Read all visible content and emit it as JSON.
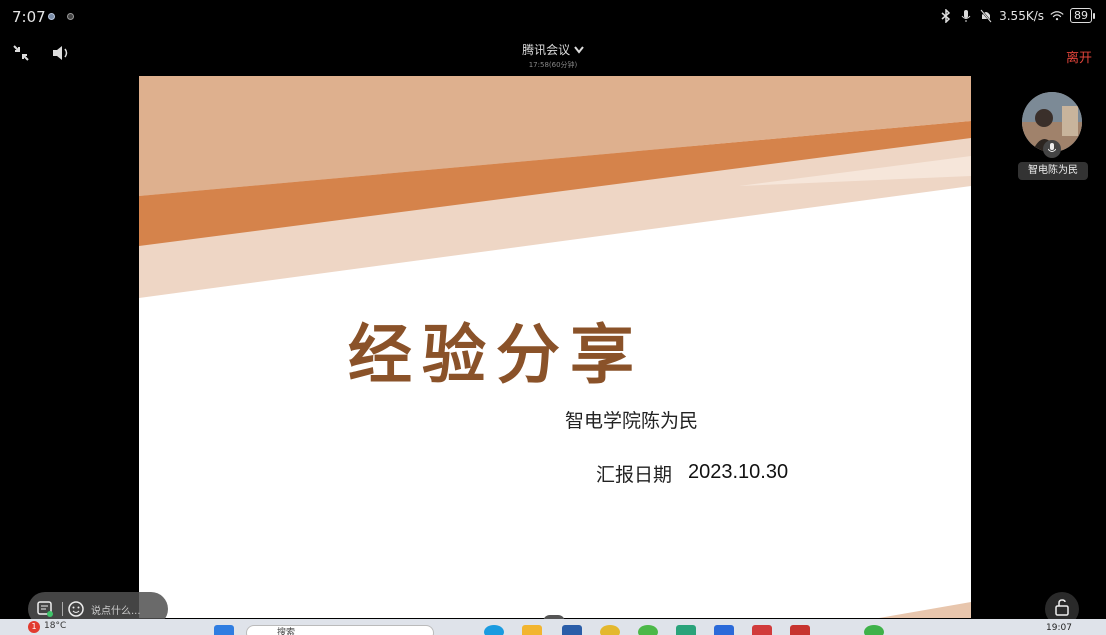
{
  "status_bar": {
    "time": "7:07",
    "network_speed": "3.55K/s",
    "battery": "89"
  },
  "toolbar": {
    "meeting_title": "腾讯会议",
    "meeting_subtitle": "17:58(60分钟)",
    "leave_label": "离开"
  },
  "slide": {
    "title": "经验分享",
    "author": "智电学院陈为民",
    "date_label": "汇报日期",
    "date": "2023.10.30",
    "colors": {
      "band_dark": "#d5834b",
      "band_mid": "#deb08e",
      "band_light": "#eed6c5",
      "title": "#8a5229"
    }
  },
  "participant": {
    "name": "智电陈为民"
  },
  "chat": {
    "placeholder": "说点什么..."
  },
  "page_indicator": "1/10",
  "taskbar": {
    "weather": "18°C",
    "notification_count": "1",
    "search_placeholder": "搜索",
    "clock": "19:07"
  },
  "icons": {
    "exit_fullscreen": "exit-fullscreen-icon",
    "speaker": "speaker-icon",
    "chevron": "chevron-down-icon",
    "bluetooth": "bluetooth-icon",
    "mic": "mic-icon",
    "mute": "notification-off-icon",
    "wifi": "wifi-icon",
    "chat": "chat-icon",
    "emoji": "emoji-icon",
    "lock": "unlock-icon"
  }
}
